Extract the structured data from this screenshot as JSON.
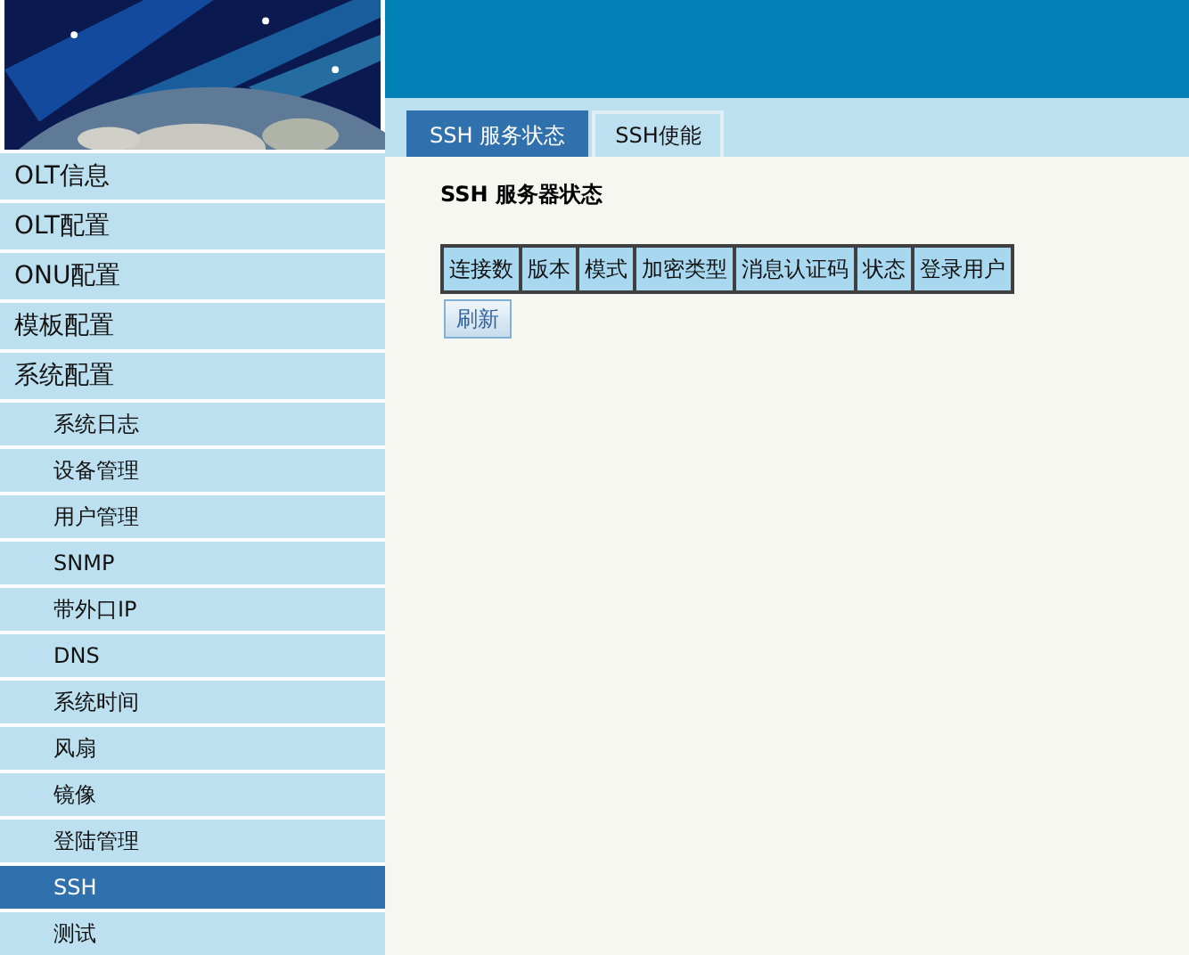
{
  "sidebar": {
    "items": [
      {
        "label": "OLT信息",
        "selected": false
      },
      {
        "label": "OLT配置",
        "selected": false
      },
      {
        "label": "ONU配置",
        "selected": false
      },
      {
        "label": "模板配置",
        "selected": false
      },
      {
        "label": "系统配置",
        "selected": false,
        "children": [
          {
            "label": "系统日志",
            "selected": false
          },
          {
            "label": "设备管理",
            "selected": false
          },
          {
            "label": "用户管理",
            "selected": false
          },
          {
            "label": "SNMP",
            "selected": false
          },
          {
            "label": "带外口IP",
            "selected": false
          },
          {
            "label": "DNS",
            "selected": false
          },
          {
            "label": "系统时间",
            "selected": false
          },
          {
            "label": "风扇",
            "selected": false
          },
          {
            "label": "镜像",
            "selected": false
          },
          {
            "label": "登陆管理",
            "selected": false
          },
          {
            "label": "SSH",
            "selected": true
          },
          {
            "label": "测试",
            "selected": false
          }
        ]
      }
    ]
  },
  "tabs": [
    {
      "label": "SSH 服务状态",
      "selected": true
    },
    {
      "label": "SSH使能",
      "selected": false
    }
  ],
  "section_title": "SSH 服务器状态",
  "table": {
    "columns": [
      "连接数",
      "版本",
      "模式",
      "加密类型",
      "消息认证码",
      "状态",
      "登录用户"
    ]
  },
  "buttons": [
    "刷新"
  ]
}
